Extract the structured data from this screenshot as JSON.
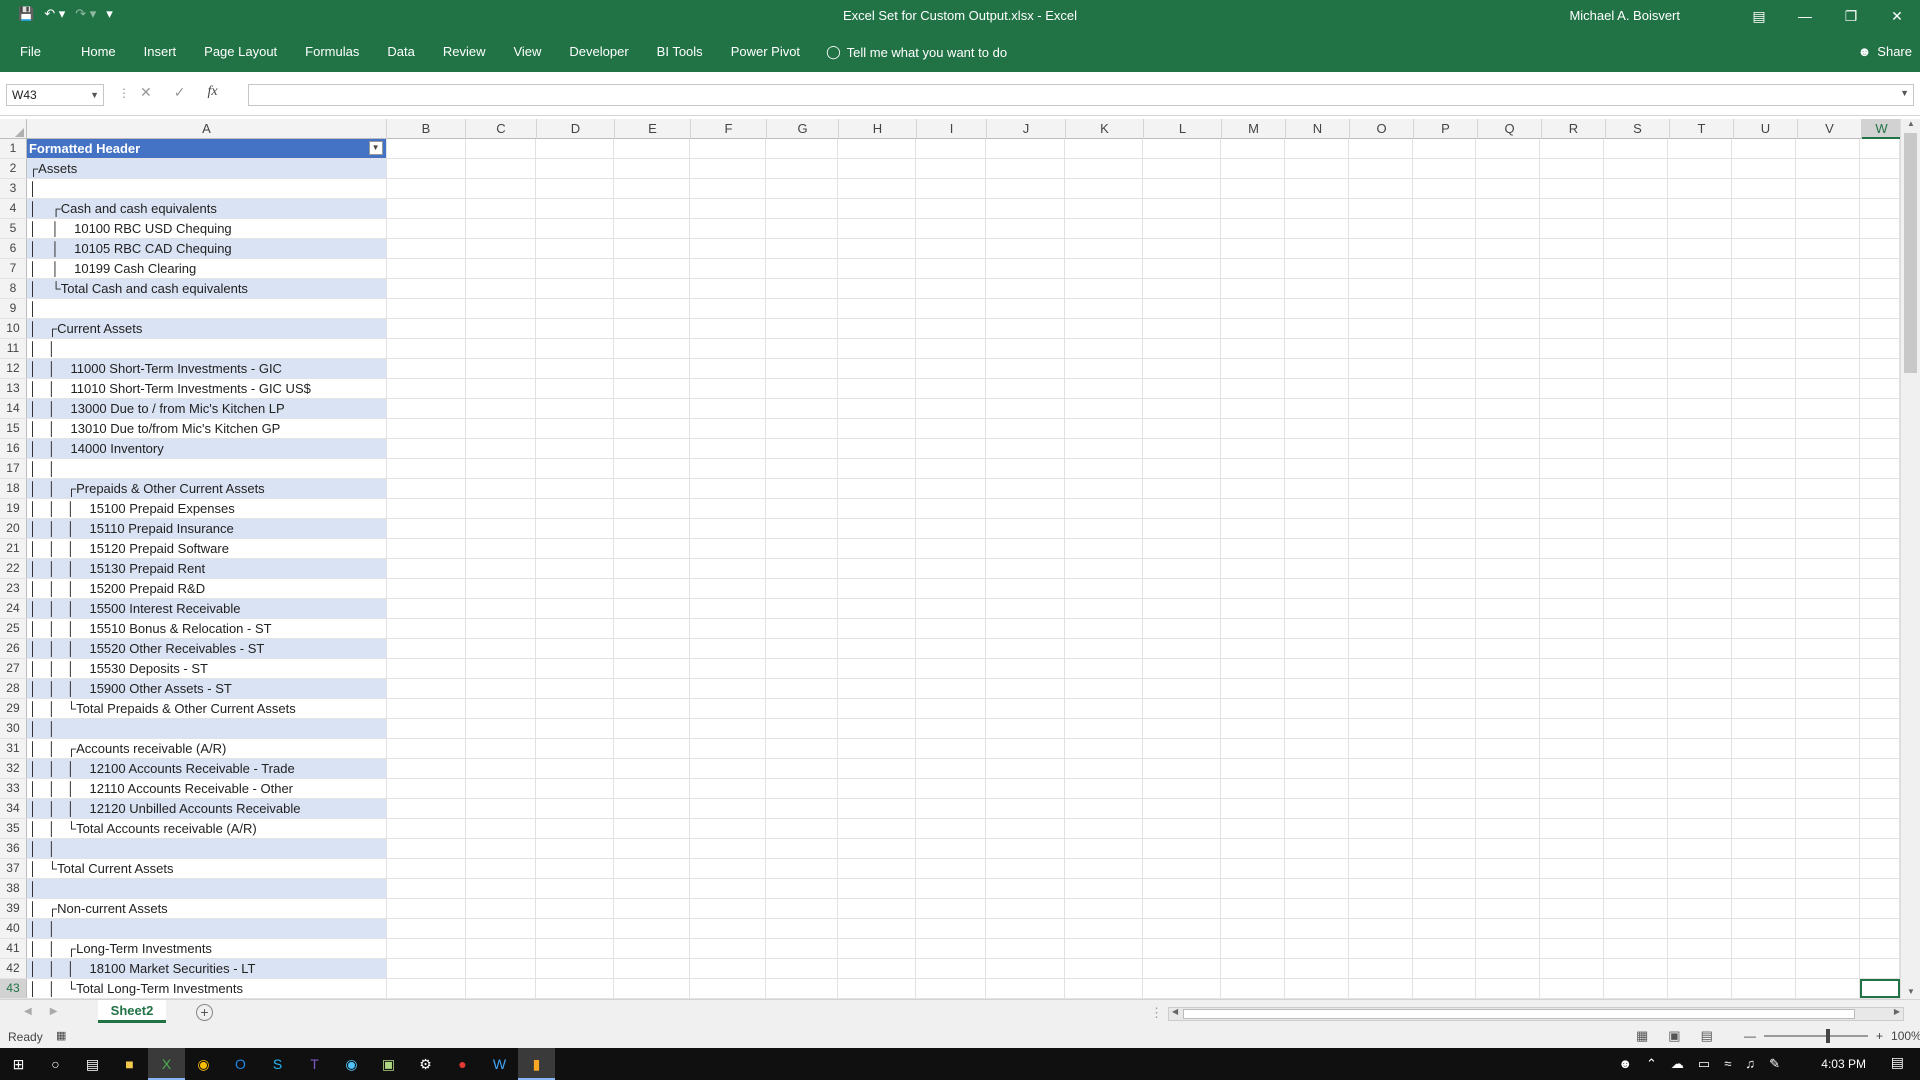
{
  "window": {
    "title": "Excel Set for Custom Output.xlsx  -  Excel",
    "user": "Michael A. Boisvert"
  },
  "ribbon": {
    "tabs": [
      "File",
      "Home",
      "Insert",
      "Page Layout",
      "Formulas",
      "Data",
      "Review",
      "View",
      "Developer",
      "BI Tools",
      "Power Pivot"
    ],
    "tell_me": "Tell me what you want to do",
    "share": "Share"
  },
  "formula_bar": {
    "name_box": "W43",
    "formula": ""
  },
  "columns": [
    "A",
    "B",
    "C",
    "D",
    "E",
    "F",
    "G",
    "H",
    "I",
    "J",
    "K",
    "L",
    "M",
    "N",
    "O",
    "P",
    "Q",
    "R",
    "S",
    "T",
    "U",
    "V",
    "W"
  ],
  "selected_column": "W",
  "selected_row": 43,
  "rows": [
    "Formatted Header",
    "┌Assets",
    "│",
    "│    ┌Cash and cash equivalents",
    "│    │    10100 RBC USD Chequing",
    "│    │    10105 RBC CAD Chequing",
    "│    │    10199 Cash Clearing",
    "│    └Total Cash and cash equivalents",
    "│",
    "│   ┌Current Assets",
    "│   │",
    "│   │    11000 Short-Term Investments - GIC",
    "│   │    11010 Short-Term Investments - GIC US$",
    "│   │    13000 Due to / from Mic's Kitchen LP",
    "│   │    13010 Due to/from Mic's Kitchen GP",
    "│   │    14000 Inventory",
    "│   │",
    "│   │   ┌Prepaids & Other Current Assets",
    "│   │   │    15100 Prepaid Expenses",
    "│   │   │    15110 Prepaid Insurance",
    "│   │   │    15120 Prepaid Software",
    "│   │   │    15130 Prepaid Rent",
    "│   │   │    15200 Prepaid R&D",
    "│   │   │    15500 Interest Receivable",
    "│   │   │    15510 Bonus & Relocation - ST",
    "│   │   │    15520 Other Receivables - ST",
    "│   │   │    15530 Deposits - ST",
    "│   │   │    15900 Other Assets - ST",
    "│   │   └Total Prepaids & Other Current Assets",
    "│   │",
    "│   │   ┌Accounts receivable (A/R)",
    "│   │   │    12100 Accounts Receivable - Trade",
    "│   │   │    12110 Accounts Receivable - Other",
    "│   │   │    12120 Unbilled Accounts Receivable",
    "│   │   └Total Accounts receivable (A/R)",
    "│   │",
    "│   └Total Current Assets",
    "│",
    "│   ┌Non-current Assets",
    "│   │",
    "│   │   ┌Long-Term Investments",
    "│   │   │    18100 Market Securities - LT",
    "│   │   └Total Long-Term Investments"
  ],
  "sheet": {
    "tab": "Sheet2"
  },
  "status": {
    "ready": "Ready",
    "zoom": "100%"
  },
  "taskbar": {
    "time": "4:03 PM"
  },
  "colors": {
    "excel_green": "#217346",
    "header_blue": "#4472c4",
    "band_blue": "#dae3f3"
  }
}
